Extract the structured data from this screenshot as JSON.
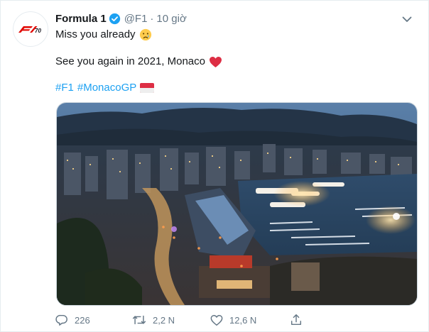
{
  "tweet": {
    "author_name": "Formula 1",
    "handle": "@F1",
    "separator": "·",
    "time": "10 giờ",
    "line1": "Miss you already",
    "line2": "See you again in 2021, Monaco",
    "hashtags": [
      "#F1",
      "#MonacoGP"
    ],
    "logo_text": "F1 70"
  },
  "actions": {
    "replies": "226",
    "retweets": "2,2 N",
    "likes": "12,6 N"
  },
  "colors": {
    "link": "#1da1f2",
    "verified": "#1da1f2",
    "heart": "#e0245e",
    "secondary_text": "#657786",
    "f1_red": "#e10600"
  },
  "icons": [
    "f1-logo-icon",
    "verified-badge-icon",
    "chevron-down-icon",
    "crying-face-emoji",
    "red-heart-emoji",
    "monaco-flag-emoji",
    "reply-icon",
    "retweet-icon",
    "like-icon",
    "share-icon"
  ]
}
